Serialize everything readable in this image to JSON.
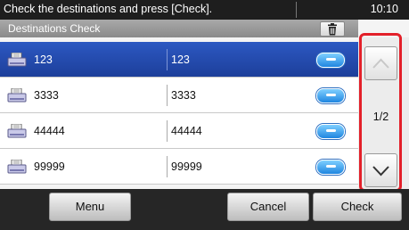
{
  "status_bar": {
    "message": "Check the destinations and press [Check].",
    "time": "10:10"
  },
  "header": {
    "title": "Destinations Check",
    "delete_icon": "trash-icon"
  },
  "destinations": [
    {
      "name": "123",
      "number": "123",
      "selected": true,
      "icon": "fax-machine-icon"
    },
    {
      "name": "3333",
      "number": "3333",
      "selected": false,
      "icon": "fax-machine-icon"
    },
    {
      "name": "44444",
      "number": "44444",
      "selected": false,
      "icon": "fax-machine-icon"
    },
    {
      "name": "99999",
      "number": "99999",
      "selected": false,
      "icon": "fax-machine-icon"
    }
  ],
  "pager": {
    "page": "1/2",
    "up_icon": "chevron-up-icon",
    "down_icon": "chevron-down-icon"
  },
  "footer": {
    "menu": "Menu",
    "cancel": "Cancel",
    "check": "Check"
  },
  "colors": {
    "selected_row": "#1d3f9a",
    "highlight_frame": "#e3202a",
    "detail_button": "#1f86e0"
  }
}
